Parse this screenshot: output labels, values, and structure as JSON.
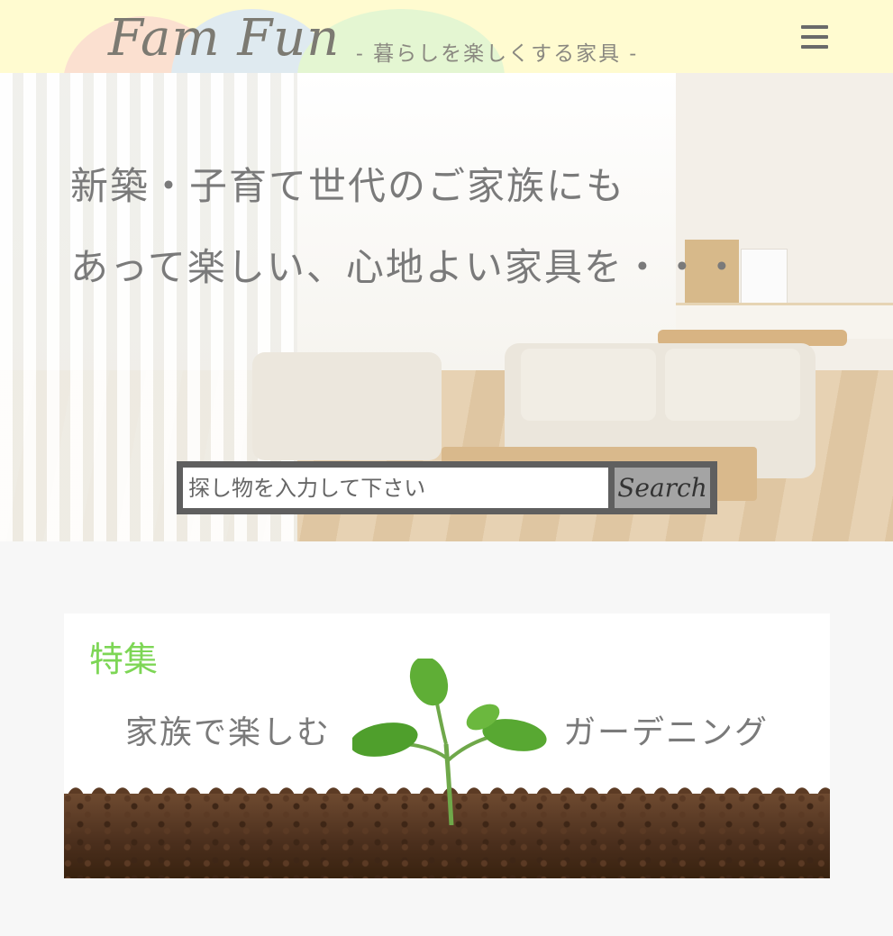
{
  "header": {
    "logo": "Fam Fun",
    "tagline": "- 暮らしを楽しくする家具 -",
    "menu_icon": "hamburger-menu-icon"
  },
  "hero": {
    "line1": "新築・子育て世代のご家族にも",
    "line2": "あって楽しい、心地よい家具を・・・",
    "search_placeholder": "探し物を入力して下さい",
    "search_button": "Search"
  },
  "feature": {
    "title": "特集",
    "left_text": "家族で楽しむ",
    "right_text": "ガーデニング",
    "image_icon": "sprout-in-soil-image"
  },
  "colors": {
    "header_bg": "#fffbd0",
    "accent_green": "#7dd655",
    "text_gray": "#7a7a7a",
    "search_frame": "#5f5f5f"
  }
}
